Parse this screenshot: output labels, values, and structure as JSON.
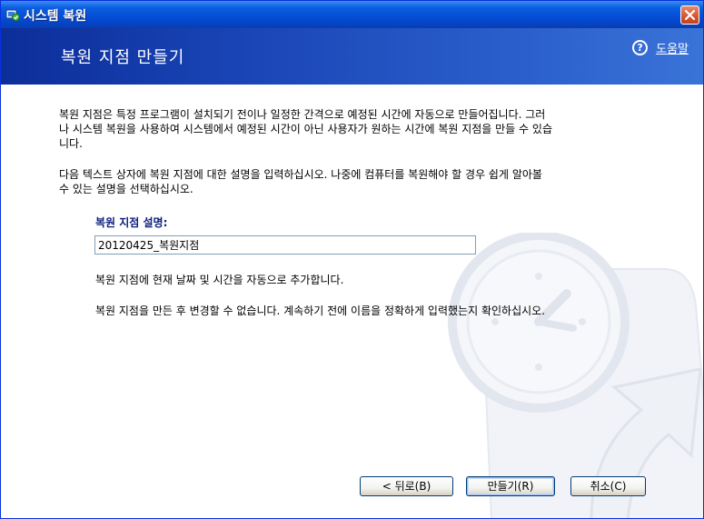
{
  "window": {
    "title": "시스템 복원",
    "close_label": "×"
  },
  "header": {
    "title": "복원 지점 만들기",
    "help_icon": "?",
    "help_label": "도움말"
  },
  "content": {
    "paragraph1": "복원 지점은 특정 프로그램이 설치되기 전이나 일정한 간격으로 예정된 시간에 자동으로 만들어집니다. 그러나 시스템 복원을 사용하여 시스템에서 예정된 시간이 아닌 사용자가 원하는 시간에 복원 지점을 만들 수 있습니다.",
    "paragraph2": "다음 텍스트 상자에 복원 지점에 대한 설명을 입력하십시오. 나중에 컴퓨터를 복원해야 할 경우 쉽게 알아볼 수 있는 설명을 선택하십시오.",
    "field_label": "복원 지점 설명:",
    "description_value": "20120425_복원지점",
    "note1": "복원 지점에 현재 날짜 및 시간을 자동으로 추가합니다.",
    "note2": "복원 지점을 만든 후 변경할 수 없습니다. 계속하기 전에 이름을 정확하게 입력했는지 확인하십시오."
  },
  "buttons": {
    "back": "< 뒤로(B)",
    "create": "만들기(R)",
    "cancel": "취소(C)"
  },
  "icons": {
    "title_icon": "system-restore-icon",
    "help_icon": "help-icon",
    "background_art": "clock-arrow-watermark"
  }
}
